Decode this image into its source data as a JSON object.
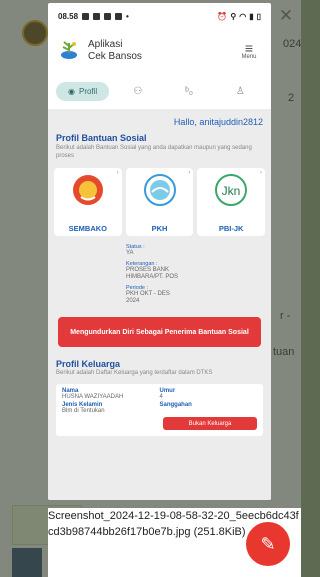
{
  "background": {
    "text_1": "024",
    "text_2": "2",
    "text_3": "r -",
    "text_4": "tuan"
  },
  "status_bar": {
    "time": "08.58"
  },
  "app": {
    "title_line1": "Aplikasi",
    "title_line2": "Cek Bansos",
    "menu_label": "Menu"
  },
  "nav": {
    "active_tab": "Profil"
  },
  "greeting": "Hallo, anitajuddin2812",
  "profil_bantuan": {
    "title": "Profil Bantuan Sosial",
    "subtitle": "Berikut adalah Bantuan Sosial yang anda dapatkan maupun yang sedang proses",
    "programs": [
      {
        "label": "SEMBAKO"
      },
      {
        "label": "PKH"
      },
      {
        "label": "PBI-JK"
      }
    ],
    "logo_text": {
      "jkn": "Jkn"
    },
    "detail": {
      "status_label": "Status :",
      "status_value": "YA",
      "keterangan_label": "Keterangan :",
      "keterangan_value": "PROSES BANK HIMBARA/PT. POS",
      "periode_label": "Periode :",
      "periode_value": "PKH OKT - DES 2024"
    },
    "action_button": "Mengundurkan Diri Sebagai Penerima Bantuan Sosial"
  },
  "profil_keluarga": {
    "title": "Profil Keluarga",
    "subtitle": "Berikut adalah Daftar Keluarga yang terdaftar dalam DTKS",
    "member": {
      "nama_label": "Nama",
      "nama_value": "HUSNA WAZIYAADAH",
      "umur_label": "Umur",
      "umur_value": "4",
      "jk_label": "Jenis Kelamin",
      "jk_value": "Blm di Tentukan",
      "sanggahan_label": "Sanggahan",
      "button_label": "Bukan Keluarga"
    }
  },
  "file_caption": "Screenshot_2024-12-19-08-58-32-20_5eecb6dc43fcd3b98744bb26f17b0e7b.jpg (251.8KiB)",
  "colors": {
    "accent_blue": "#1e5fb4",
    "danger_red": "#e23a3a",
    "pill_bg": "#cfe7e4"
  }
}
